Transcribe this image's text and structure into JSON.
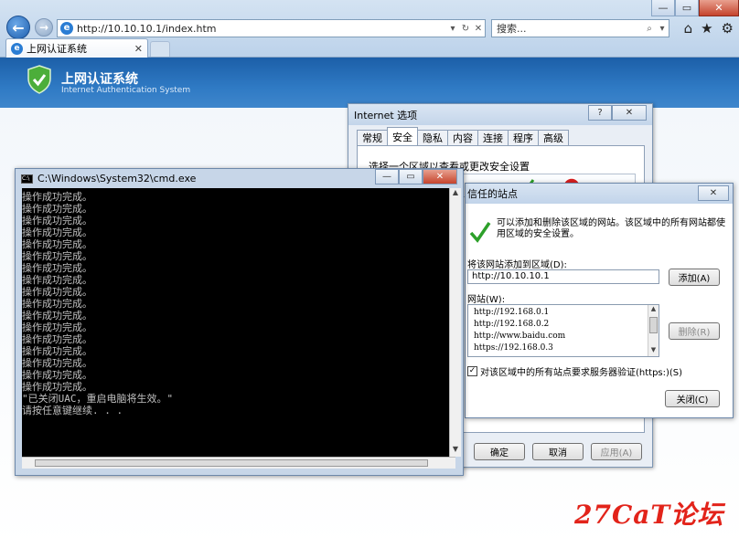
{
  "browser": {
    "url": "http://10.10.10.1/index.htm",
    "search_placeholder": "搜索...",
    "tab_title": "上网认证系统",
    "nav_back_glyph": "←",
    "nav_forward_glyph": "→"
  },
  "page": {
    "title": "上网认证系统",
    "subtitle": "Internet Authentication System",
    "accent_color": "#2f7ac4"
  },
  "internet_options": {
    "title": "Internet 选项",
    "tabs": [
      "常规",
      "安全",
      "隐私",
      "内容",
      "连接",
      "程序",
      "高级"
    ],
    "active_tab": "安全",
    "zone_prompt": "选择一个区域以查看或更改安全设置",
    "buttons": {
      "ok": "确定",
      "cancel": "取消",
      "apply": "应用(A)"
    }
  },
  "trusted_sites": {
    "title": "信任的站点",
    "description": "可以添加和删除该区域的网站。该区域中的所有网站都使用区域的安全设置。",
    "add_label": "将该网站添加到区域(D):",
    "input_value": "http://10.10.10.1",
    "add_button": "添加(A)",
    "sites_label": "网站(W):",
    "sites": [
      "http://192.168.0.1",
      "http://192.168.0.2",
      "http://www.baidu.com",
      "https://192.168.0.3"
    ],
    "remove_button": "删除(R)",
    "https_check_label": "对该区域中的所有站点要求服务器验证(https:)(S)",
    "https_checked": true,
    "close_button": "关闭(C)"
  },
  "cmd": {
    "title": "C:\\Windows\\System32\\cmd.exe",
    "lines": [
      "操作成功完成。",
      "操作成功完成。",
      "操作成功完成。",
      "操作成功完成。",
      "操作成功完成。",
      "操作成功完成。",
      "操作成功完成。",
      "操作成功完成。",
      "操作成功完成。",
      "操作成功完成。",
      "操作成功完成。",
      "操作成功完成。",
      "操作成功完成。",
      "操作成功完成。",
      "操作成功完成。",
      "操作成功完成。",
      "操作成功完成。",
      "\"已关闭UAC，重启电脑将生效。\"",
      "请按任意键继续. . ."
    ]
  },
  "watermark": "27CaT论坛"
}
